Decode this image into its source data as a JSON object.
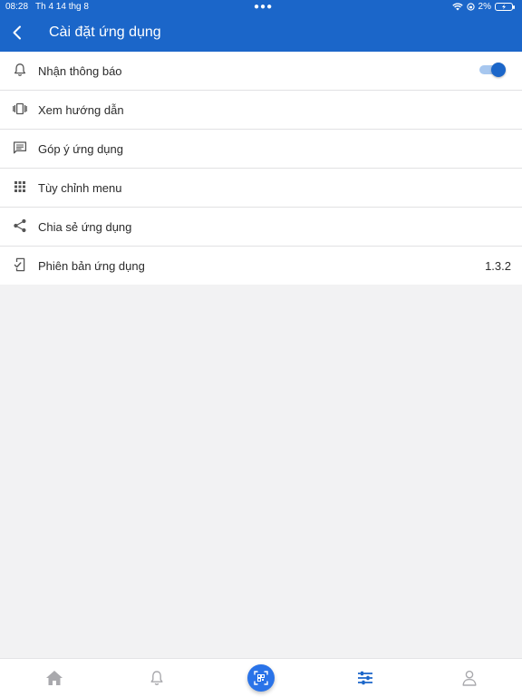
{
  "status_bar": {
    "time": "08:28",
    "date": "Th 4 14 thg 8",
    "battery": "2%"
  },
  "header": {
    "title": "Cài đặt ứng dụng"
  },
  "colors": {
    "primary": "#1b66c9",
    "background": "#f2f2f3",
    "active_tab": "#1b66c9",
    "inactive_tab": "#a9a9ad"
  },
  "settings": {
    "items": [
      {
        "label": "Nhận thông báo",
        "icon": "bell-icon",
        "toggle_on": true
      },
      {
        "label": "Xem hướng dẫn",
        "icon": "carousel-icon"
      },
      {
        "label": "Góp ý ứng dụng",
        "icon": "feedback-icon"
      },
      {
        "label": "Tùy chỉnh menu",
        "icon": "grid-icon"
      },
      {
        "label": "Chia sẻ ứng dụng",
        "icon": "share-icon"
      },
      {
        "label": "Phiên bản ứng dụng",
        "icon": "phone-check-icon",
        "value": "1.3.2"
      }
    ]
  },
  "tabbar": {
    "tabs": [
      {
        "icon": "home-icon",
        "active": false
      },
      {
        "icon": "bell-icon",
        "active": false
      },
      {
        "icon": "scan-icon",
        "active": false
      },
      {
        "icon": "sliders-icon",
        "active": true
      },
      {
        "icon": "user-icon",
        "active": false
      }
    ]
  }
}
